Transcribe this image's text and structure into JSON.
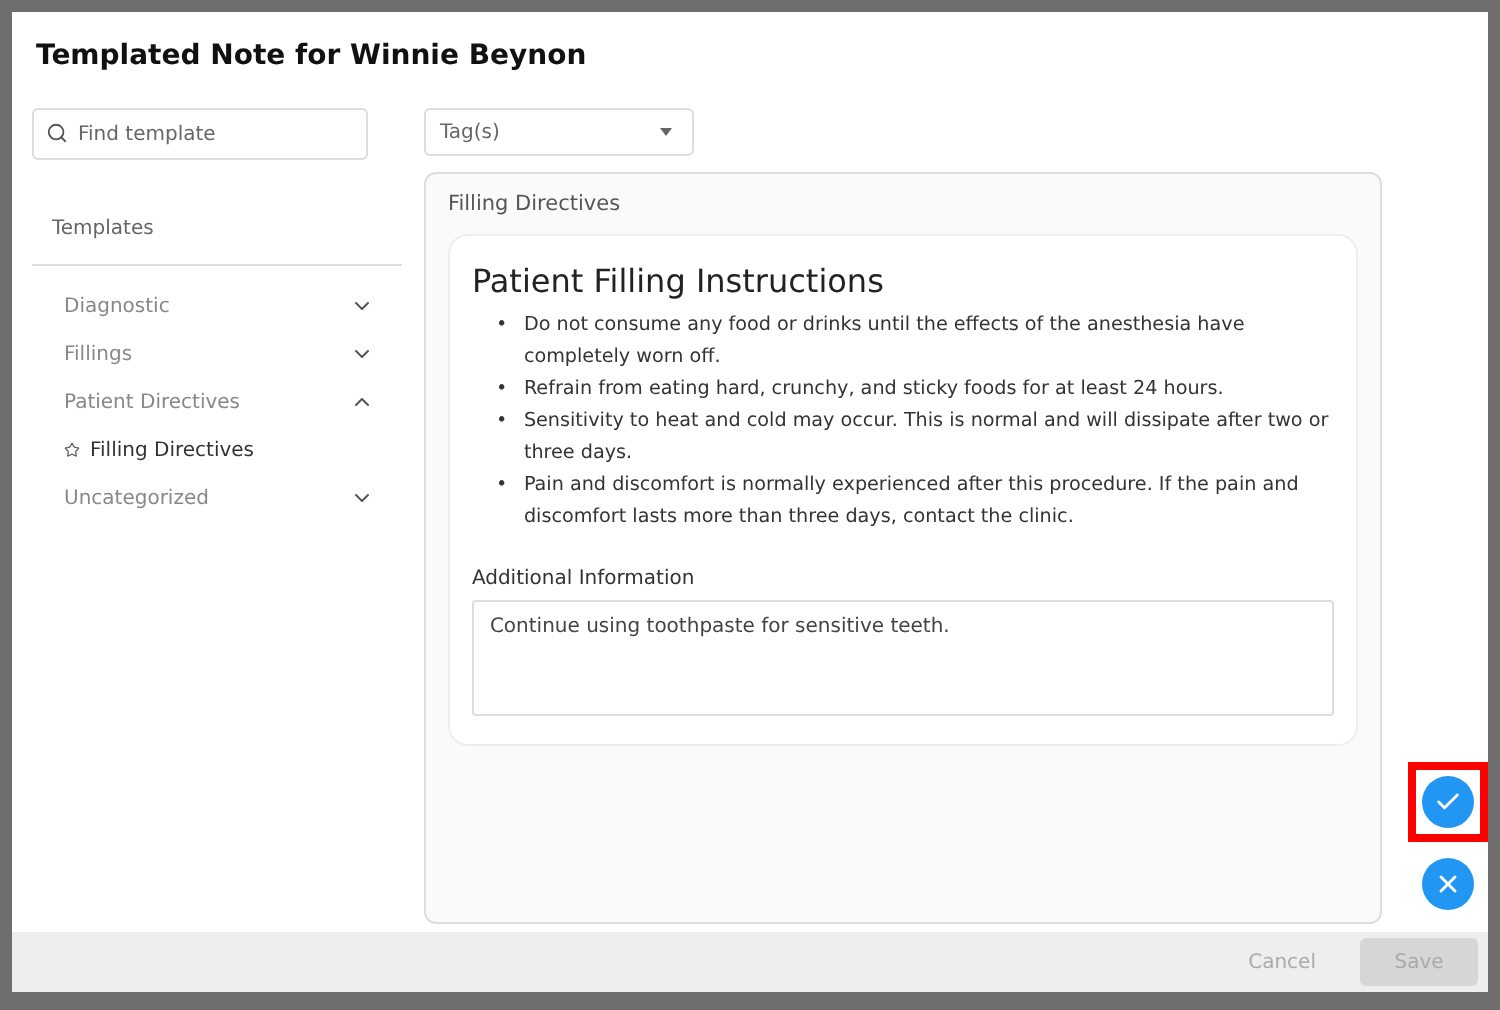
{
  "dialog": {
    "title": "Templated Note for Winnie Beynon"
  },
  "search": {
    "placeholder": "Find template"
  },
  "tags": {
    "placeholder": "Tag(s)"
  },
  "sidebar": {
    "heading": "Templates",
    "items": [
      {
        "kind": "category",
        "label": "Diagnostic",
        "expanded": false,
        "selected": false
      },
      {
        "kind": "category",
        "label": "Fillings",
        "expanded": false,
        "selected": false
      },
      {
        "kind": "category",
        "label": "Patient Directives",
        "expanded": true,
        "selected": false
      },
      {
        "kind": "template",
        "label": "Filling Directives",
        "selected": true
      },
      {
        "kind": "category",
        "label": "Uncategorized",
        "expanded": false,
        "selected": false
      }
    ]
  },
  "panel": {
    "header": "Filling Directives",
    "title": "Patient Filling Instructions",
    "bullets": [
      {
        "marker": "•",
        "text": "Do not consume any food or drinks until the effects of the anesthesia have completely worn off."
      },
      {
        "marker": "•",
        "text": "Refrain from eating hard, crunchy, and sticky foods for at least 24 hours."
      },
      {
        "marker": "•",
        "text": "Sensitivity to heat and cold may occur. This is normal and will dissipate after two or three days."
      },
      {
        "marker": "•",
        "text": "Pain and discomfort is normally experienced after this procedure. If the pain and discomfort lasts more than three days, contact the clinic."
      }
    ],
    "additional_label": "Additional Information",
    "additional_value": "Continue using toothpaste for sensitive teeth."
  },
  "actions": [
    {
      "kind": "confirm",
      "highlighted": true
    },
    {
      "kind": "dismiss",
      "highlighted": false
    }
  ],
  "footer": {
    "buttons": [
      {
        "label": "Cancel",
        "kind": "text",
        "disabled": true
      },
      {
        "label": "Save",
        "kind": "filled",
        "disabled": true
      }
    ]
  }
}
